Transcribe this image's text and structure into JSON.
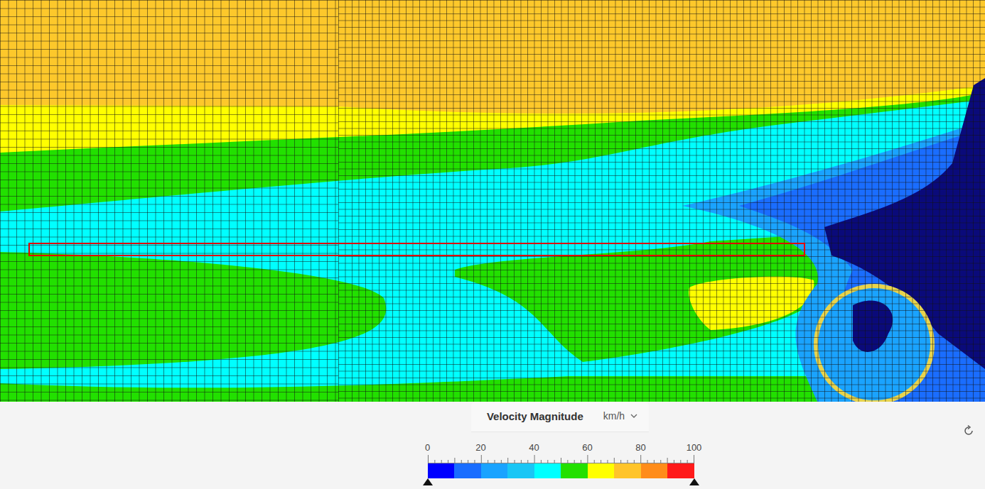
{
  "legend": {
    "title": "Velocity Magnitude",
    "unit": "km/h",
    "ticks": [
      "0",
      "20",
      "40",
      "60",
      "80",
      "100"
    ],
    "bands": [
      {
        "color": "#0000ff"
      },
      {
        "color": "#1a6dff"
      },
      {
        "color": "#1aa3ff"
      },
      {
        "color": "#1ac6f5"
      },
      {
        "color": "#00ffff"
      },
      {
        "color": "#22e000"
      },
      {
        "color": "#ffff00"
      },
      {
        "color": "#ffc42a"
      },
      {
        "color": "#ff8c1a"
      },
      {
        "color": "#ff1a1a"
      }
    ],
    "range": {
      "min_level": 0,
      "max_level": 1
    }
  }
}
